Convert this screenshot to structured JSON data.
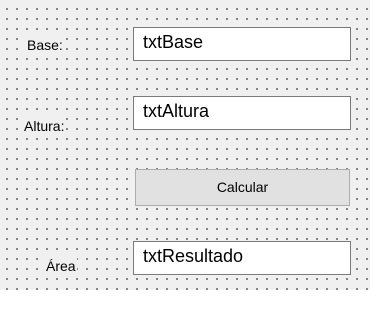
{
  "form": {
    "labels": {
      "base": "Base:",
      "altura": "Altura:",
      "area": "Área"
    },
    "textboxes": {
      "base": "txtBase",
      "altura": "txtAltura",
      "resultado": "txtResultado"
    },
    "calcular_button": "Calcular"
  }
}
